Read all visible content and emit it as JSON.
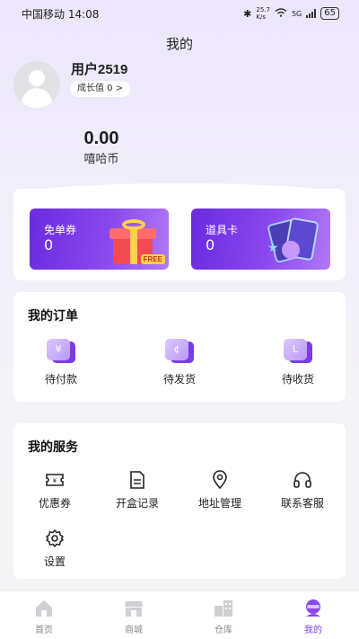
{
  "status_bar": {
    "carrier": "中国移动",
    "time": "14:08",
    "net_speed": "25.7",
    "net_unit": "K/s",
    "network": "5G",
    "battery": "65"
  },
  "page_title": "我的",
  "profile": {
    "username": "用户2519",
    "growth_label": "成长值 0 >"
  },
  "balance": {
    "value": "0.00",
    "label": "嘻哈币"
  },
  "tickets": [
    {
      "label": "免单券",
      "value": "0",
      "badge": "FREE"
    },
    {
      "label": "道具卡",
      "value": "0"
    }
  ],
  "orders": {
    "title": "我的订单",
    "items": [
      {
        "label": "待付款",
        "icon": "payment-icon"
      },
      {
        "label": "待发货",
        "icon": "shipping-icon"
      },
      {
        "label": "待收货",
        "icon": "receive-icon"
      }
    ]
  },
  "services": {
    "title": "我的服务",
    "items": [
      {
        "label": "优惠券",
        "icon": "coupon-icon"
      },
      {
        "label": "开盒记录",
        "icon": "document-icon"
      },
      {
        "label": "地址管理",
        "icon": "location-icon"
      },
      {
        "label": "联系客服",
        "icon": "headset-icon"
      },
      {
        "label": "设置",
        "icon": "gear-icon"
      }
    ]
  },
  "tabbar": {
    "items": [
      {
        "label": "首页",
        "icon": "home-icon"
      },
      {
        "label": "商城",
        "icon": "shop-icon"
      },
      {
        "label": "仓库",
        "icon": "warehouse-icon"
      },
      {
        "label": "我的",
        "icon": "profile-icon",
        "active": true
      }
    ]
  },
  "colors": {
    "accent": "#7b3be6",
    "ticket_gradient_start": "#6a2be0",
    "ticket_gradient_end": "#b07af7"
  }
}
